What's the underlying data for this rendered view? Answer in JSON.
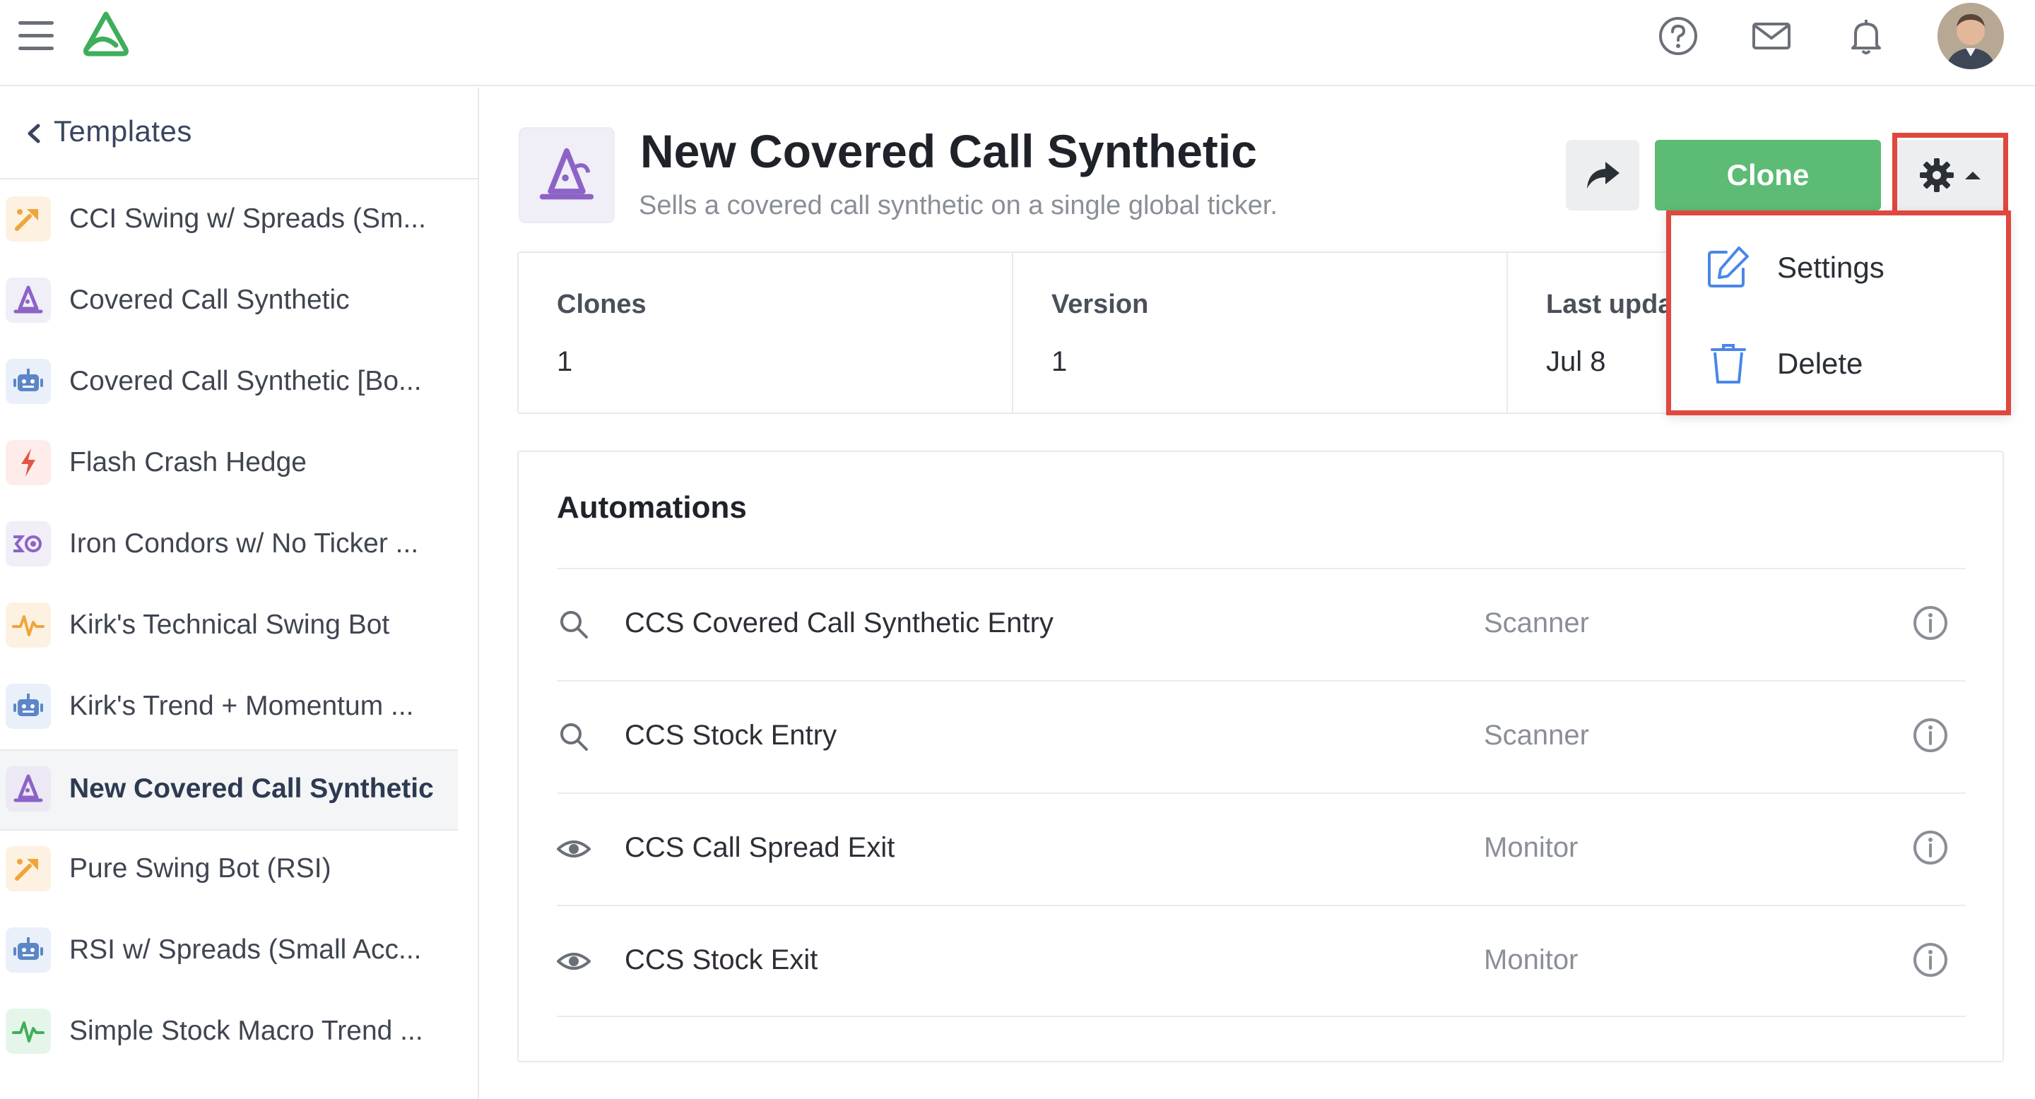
{
  "colors": {
    "accent_green": "#5cbb74",
    "logo_green": "#3fae5a",
    "highlight_red": "#e0473f",
    "icon_purple": "#8d63c7",
    "icon_blue": "#5b86c8",
    "icon_orange": "#f0a53a",
    "icon_red": "#e0574a",
    "info_blue": "#4a86e8"
  },
  "topbar": {
    "icons": [
      "hamburger-icon",
      "logo-icon",
      "help-icon",
      "mail-icon",
      "bell-icon",
      "avatar"
    ]
  },
  "sidebar": {
    "title": "Templates",
    "items": [
      {
        "label": "CCI Swing w/ Spreads (Sm...",
        "icon": "sparkle-arrow-icon",
        "active": false
      },
      {
        "label": "Covered Call Synthetic",
        "icon": "wizard-hat-icon",
        "active": false
      },
      {
        "label": "Covered Call Synthetic [Bo...",
        "icon": "robot-icon",
        "active": false
      },
      {
        "label": "Flash Crash Hedge",
        "icon": "lightning-icon",
        "active": false
      },
      {
        "label": "Iron Condors w/ No Ticker ...",
        "icon": "condor-icon",
        "active": false
      },
      {
        "label": "Kirk's Technical Swing Bot",
        "icon": "pulse-icon",
        "active": false
      },
      {
        "label": "Kirk's Trend + Momentum ...",
        "icon": "robot-icon",
        "active": false
      },
      {
        "label": "New Covered Call Synthetic",
        "icon": "wizard-hat-icon",
        "active": true
      },
      {
        "label": "Pure Swing Bot (RSI)",
        "icon": "sparkle-arrow-icon",
        "active": false
      },
      {
        "label": "RSI w/ Spreads (Small Acc...",
        "icon": "robot-icon",
        "active": false
      },
      {
        "label": "Simple Stock Macro Trend ...",
        "icon": "pulse-icon",
        "active": false
      }
    ]
  },
  "template": {
    "title": "New Covered Call Synthetic",
    "subtitle": "Sells a covered call synthetic on a single global ticker.",
    "icon": "wizard-hat-icon",
    "clone_label": "Clone"
  },
  "stats": [
    {
      "label": "Clones",
      "value": "1"
    },
    {
      "label": "Version",
      "value": "1"
    },
    {
      "label": "Last upda",
      "value": "Jul 8"
    }
  ],
  "automations": {
    "title": "Automations",
    "rows": [
      {
        "name": "CCS Covered Call Synthetic Entry",
        "type": "Scanner",
        "icon": "search-icon"
      },
      {
        "name": "CCS Stock Entry",
        "type": "Scanner",
        "icon": "search-icon"
      },
      {
        "name": "CCS Call Spread Exit",
        "type": "Monitor",
        "icon": "eye-icon"
      },
      {
        "name": "CCS Stock Exit",
        "type": "Monitor",
        "icon": "eye-icon"
      }
    ]
  },
  "dropdown": {
    "items": [
      {
        "label": "Settings",
        "icon": "edit-icon"
      },
      {
        "label": "Delete",
        "icon": "trash-icon"
      }
    ]
  }
}
